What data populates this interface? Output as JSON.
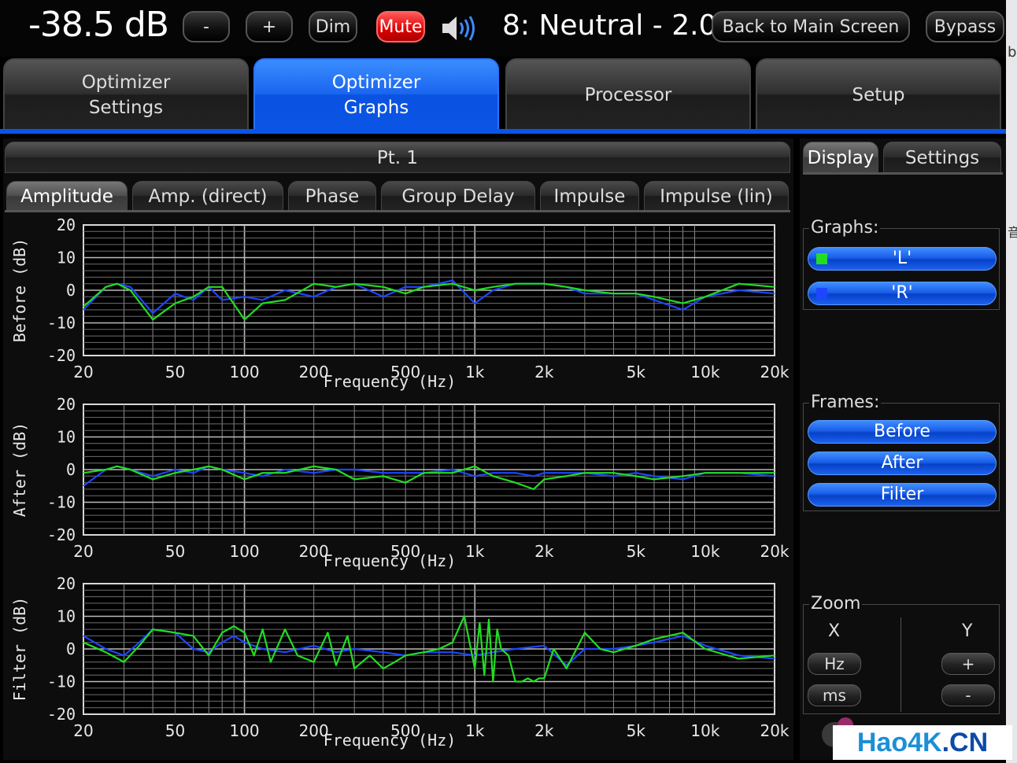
{
  "topbar": {
    "volume": "-38.5 dB",
    "minus_label": "-",
    "plus_label": "+",
    "dim_label": "Dim",
    "mute_label": "Mute",
    "preset": "8: Neutral - 2.0",
    "back_label": "Back to Main Screen",
    "bypass_label": "Bypass"
  },
  "right_strip": {
    "top_char": "b",
    "mid_char": "音"
  },
  "main_tabs": [
    {
      "label": "Optimizer\nSettings",
      "active": false
    },
    {
      "label": "Optimizer\nGraphs",
      "active": true
    },
    {
      "label": "Processor",
      "active": false
    },
    {
      "label": "Setup",
      "active": false
    }
  ],
  "panel": {
    "header": "Pt. 1",
    "subtabs": [
      "Amplitude",
      "Amp. (direct)",
      "Phase",
      "Group Delay",
      "Impulse",
      "Impulse (lin)"
    ],
    "active_subtab": "Amplitude"
  },
  "side_tabs": [
    "Display",
    "Settings"
  ],
  "display": {
    "graphs_label": "Graphs:",
    "graphs": [
      {
        "label": "'L'",
        "color": "#22dd22"
      },
      {
        "label": "'R'",
        "color": "#1e46ff"
      }
    ],
    "frames_label": "Frames:",
    "frames": [
      "Before",
      "After",
      "Filter"
    ],
    "zoom_label": "Zoom",
    "zoom_x": "X",
    "zoom_y": "Y",
    "zoom_x_buttons": [
      "Hz",
      "ms"
    ],
    "zoom_y_buttons": [
      "+",
      "-"
    ]
  },
  "colors": {
    "accent": "#0a55e8",
    "series_L": "#22dd22",
    "series_R": "#1e46ff",
    "mute": "#e00000"
  },
  "watermark": {
    "part1": "Hao4K",
    "dot": ".",
    "part2": "CN"
  },
  "chart_data": [
    {
      "type": "line",
      "x_scale": "log",
      "xlim": [
        20,
        20000
      ],
      "ylim": [
        -20,
        20
      ],
      "ylabel": "Before (dB)",
      "xlabel": "Frequency (Hz)",
      "x_ticks": [
        "20",
        "50",
        "100",
        "200",
        "500",
        "1k",
        "2k",
        "5k",
        "10k",
        "20k"
      ],
      "y_ticks": [
        "20",
        "10",
        "0",
        "-10",
        "-20"
      ],
      "grid": true,
      "series": [
        {
          "name": "'L'",
          "x": [
            20,
            25,
            28,
            32,
            40,
            50,
            60,
            70,
            80,
            100,
            120,
            150,
            200,
            250,
            300,
            400,
            500,
            600,
            800,
            1000,
            1200,
            1500,
            2000,
            2500,
            3000,
            4000,
            5000,
            6000,
            8000,
            10000,
            14000,
            20000
          ],
          "y": [
            -5,
            1,
            2,
            0,
            -9,
            -4,
            -2,
            1,
            1,
            -9,
            -4,
            -3,
            2,
            1,
            2,
            1,
            -1,
            1,
            2,
            0,
            1,
            2,
            2,
            1,
            0,
            -1,
            -1,
            -2,
            -4,
            -2,
            2,
            1
          ]
        },
        {
          "name": "'R'",
          "x": [
            20,
            25,
            28,
            32,
            40,
            50,
            60,
            70,
            80,
            100,
            120,
            150,
            200,
            250,
            300,
            400,
            500,
            600,
            800,
            1000,
            1200,
            1500,
            2000,
            2500,
            3000,
            4000,
            5000,
            6000,
            8000,
            10000,
            14000,
            20000
          ],
          "y": [
            -6,
            1,
            2,
            1,
            -7,
            -1,
            -3,
            1,
            -3,
            -2,
            -3,
            0,
            -2,
            1,
            2,
            -2,
            1,
            1,
            3,
            -4,
            0,
            2,
            2,
            1,
            -1,
            -1,
            -1,
            -3,
            -6,
            -2,
            0,
            -1
          ]
        }
      ]
    },
    {
      "type": "line",
      "x_scale": "log",
      "xlim": [
        20,
        20000
      ],
      "ylim": [
        -20,
        20
      ],
      "ylabel": "After (dB)",
      "xlabel": "Frequency (Hz)",
      "x_ticks": [
        "20",
        "50",
        "100",
        "200",
        "500",
        "1k",
        "2k",
        "5k",
        "10k",
        "20k"
      ],
      "y_ticks": [
        "20",
        "10",
        "0",
        "-10",
        "-20"
      ],
      "grid": true,
      "series": [
        {
          "name": "'L'",
          "x": [
            20,
            25,
            28,
            32,
            40,
            50,
            60,
            70,
            80,
            100,
            120,
            150,
            200,
            250,
            300,
            400,
            500,
            600,
            800,
            1000,
            1200,
            1500,
            1800,
            2000,
            2500,
            3000,
            4000,
            5000,
            6000,
            8000,
            10000,
            14000,
            20000
          ],
          "y": [
            -1,
            0,
            1,
            0,
            -3,
            -1,
            0,
            1,
            0,
            -3,
            -1,
            -1,
            1,
            0,
            -3,
            -2,
            -4,
            -1,
            -1,
            1,
            -2,
            -4,
            -6,
            -3,
            -2,
            -1,
            -1,
            -2,
            -3,
            -2,
            -1,
            -1,
            -1
          ]
        },
        {
          "name": "'R'",
          "x": [
            20,
            25,
            28,
            32,
            40,
            50,
            60,
            70,
            80,
            100,
            120,
            150,
            200,
            250,
            300,
            400,
            500,
            600,
            800,
            1000,
            1200,
            1500,
            1800,
            2000,
            2500,
            3000,
            4000,
            5000,
            6000,
            8000,
            10000,
            14000,
            20000
          ],
          "y": [
            -5,
            0,
            1,
            0,
            -2,
            0,
            -1,
            1,
            0,
            -1,
            -2,
            0,
            -1,
            0,
            0,
            -1,
            -1,
            -1,
            0,
            -2,
            -1,
            -1,
            -2,
            -1,
            -1,
            -1,
            -2,
            -1,
            -2,
            -3,
            -1,
            -1,
            -2
          ]
        }
      ]
    },
    {
      "type": "line",
      "x_scale": "log",
      "xlim": [
        20,
        20000
      ],
      "ylim": [
        -20,
        20
      ],
      "ylabel": "Filter (dB)",
      "xlabel": "Frequency (Hz)",
      "x_ticks": [
        "20",
        "50",
        "100",
        "200",
        "500",
        "1k",
        "2k",
        "5k",
        "10k",
        "20k"
      ],
      "y_ticks": [
        "20",
        "10",
        "0",
        "-10",
        "-20"
      ],
      "grid": true,
      "series": [
        {
          "name": "'L'",
          "x": [
            20,
            25,
            30,
            35,
            40,
            50,
            60,
            70,
            80,
            90,
            100,
            110,
            120,
            130,
            150,
            170,
            200,
            230,
            250,
            280,
            300,
            350,
            400,
            450,
            500,
            600,
            700,
            800,
            900,
            1000,
            1050,
            1100,
            1150,
            1200,
            1250,
            1300,
            1400,
            1500,
            1600,
            1700,
            1800,
            1900,
            2000,
            2200,
            2500,
            3000,
            3500,
            4000,
            5000,
            6000,
            8000,
            10000,
            14000,
            20000
          ],
          "y": [
            2,
            -1,
            -4,
            1,
            6,
            5,
            4,
            -2,
            5,
            7,
            5,
            -2,
            6,
            -4,
            6,
            -2,
            -4,
            5,
            -5,
            4,
            -6,
            -2,
            -6,
            -4,
            -2,
            -1,
            0,
            2,
            10,
            -6,
            8,
            -8,
            9,
            -10,
            6,
            0,
            -2,
            -10,
            -10,
            -9,
            -10,
            -9,
            -9,
            0,
            -6,
            5,
            0,
            -1,
            1,
            3,
            5,
            0,
            -3,
            -2
          ]
        },
        {
          "name": "'R'",
          "x": [
            20,
            25,
            30,
            35,
            40,
            50,
            60,
            70,
            80,
            90,
            100,
            120,
            150,
            200,
            250,
            300,
            400,
            500,
            600,
            800,
            1000,
            1200,
            1500,
            2000,
            2500,
            3000,
            4000,
            5000,
            6000,
            8000,
            10000,
            14000,
            20000
          ],
          "y": [
            4,
            0,
            -2,
            2,
            6,
            5,
            0,
            -1,
            2,
            4,
            2,
            0,
            -1,
            1,
            -1,
            0,
            -1,
            -2,
            -1,
            -1,
            -2,
            -1,
            0,
            1,
            -5,
            0,
            0,
            1,
            2,
            4,
            1,
            -2,
            -3
          ]
        }
      ]
    }
  ]
}
